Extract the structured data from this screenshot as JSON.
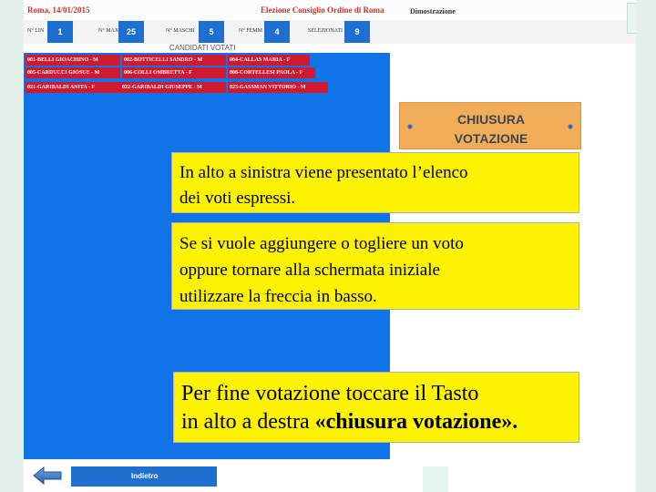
{
  "header": {
    "left_title": "Roma, 14/01/2015",
    "center_title": "Elezione Consiglio Ordine di Roma",
    "demo_label": "Dimostrazione"
  },
  "stats": [
    {
      "label": "N° LIN",
      "value": "1"
    },
    {
      "label": "N° MAX",
      "value": "25"
    },
    {
      "label": "N° MASCHI",
      "value": "5"
    },
    {
      "label": "N° FEMM",
      "value": "4"
    },
    {
      "label": "SELEZIONATI",
      "value": "9"
    }
  ],
  "voted_title": "CANDIDATI VOTATI",
  "candidates": [
    "001-BELLI GIOACHINO - M",
    "002-BOTTICELLI SANDRO - M",
    "004-CALLAS MARIA - F",
    "005-CARDUCCI GIOSUE - M",
    "006-COLLI OMBRETTA - F",
    "008-CORTELLESI PAOLA - F",
    "021-GARIBALDI ANITA - F",
    "022-GARIBALDI GIUSEPPE - M",
    "023-GASSMAN VITTORIO - M"
  ],
  "close_button": {
    "line1": "CHIUSURA",
    "line2": "VOTAZIONE"
  },
  "notes": {
    "note1_line1": " In alto a sinistra viene presentato l’elenco",
    "note1_line2": "dei voti espressi.",
    "note2_line1": "Se si vuole aggiungere o togliere un voto",
    "note2_line2": "oppure tornare alla schermata iniziale",
    "note2_line3": "utilizzare la freccia in basso.",
    "note3_line1": "Per fine votazione toccare il Tasto",
    "note3_line2_prefix": "in alto a destra ",
    "note3_line2_bold": "«chiusura votazione»."
  },
  "back_button": "Indietro",
  "colors": {
    "panel_blue": "#1073e8",
    "chip_red": "#d0192e",
    "note_yellow": "#fdf200",
    "close_orange": "#f1ad5a"
  }
}
